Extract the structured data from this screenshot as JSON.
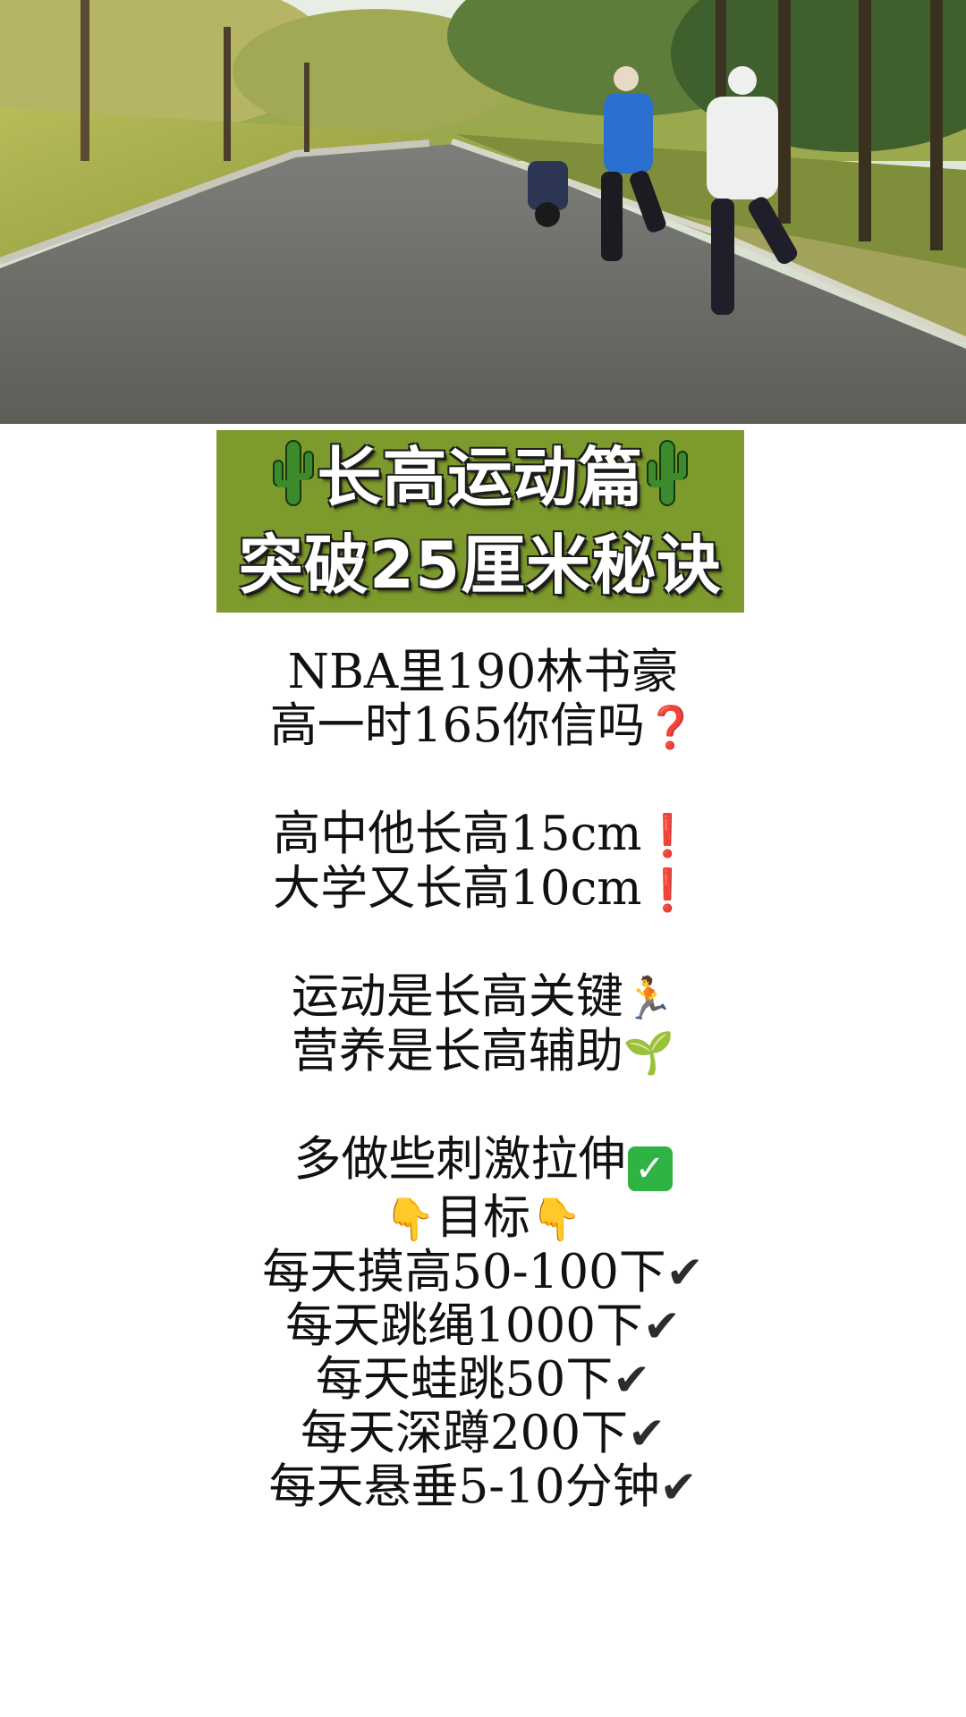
{
  "banner": {
    "line1": "长高运动篇",
    "line2": "突破25厘米秘诀",
    "color": "#7d9a2c"
  },
  "body": {
    "l1": "NBA里190林书豪",
    "l2": "高一时165你信吗",
    "l3": "高中他长高15cm",
    "l4": "大学又长高10cm",
    "l5": "运动是长高关键",
    "l6": "营养是长高辅助",
    "l7": "多做些刺激拉伸",
    "l8": "目标",
    "l9": "每天摸高50-100下",
    "l10": "每天跳绳1000下",
    "l11": "每天蛙跳50下",
    "l12": "每天深蹲200下",
    "l13": "每天悬垂5-10分钟"
  },
  "icons": {
    "question": "❓",
    "exclaim": "❗",
    "runner": "🏃",
    "sprout": "🌱",
    "checkbox": "✅",
    "hand_down": "👇",
    "check": "✔"
  }
}
